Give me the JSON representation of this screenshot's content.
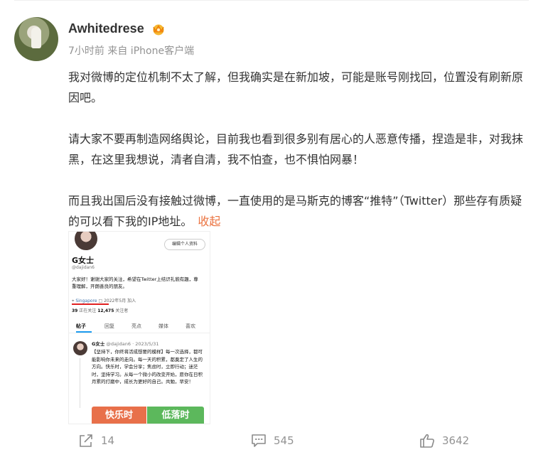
{
  "post": {
    "username": "Awhitedrese",
    "meta": "7小时前 来自 iPhone客户端",
    "paragraphs": [
      "我对微博的定位机制不太了解，但我确实是在新加坡，可能是账号刚找回，位置没有刷新原因吧。",
      "请大家不要再制造网络舆论，目前我也看到很多别有居心的人恶意传播，捏造是非，对我抹黑，在这里我想说，清者自清，我不怕查，也不惧怕网暴！",
      "而且我出国后没有接触过微博，一直使用的是马斯克的博客“推特”（Twitter）那些存有质疑的可以看下我的IP地址。"
    ],
    "collapse_label": "收起",
    "accent_color": "#eb7340"
  },
  "embedded_screenshot": {
    "edit_profile_label": "编辑个人资料",
    "display_name": "G女士",
    "handle": "@dajidan6",
    "bio": "大家好！谢谢大家的关注，希望在Twitter上结识礼貌有趣，尊重理解，开朗善良的朋友。",
    "location": "Singapore",
    "joined": "2022年5月 加入",
    "following_count": "39",
    "following_label": "正在关注",
    "followers_count": "12,475",
    "followers_label": "关注者",
    "tabs": [
      "帖子",
      "回复",
      "亮点",
      "媒体",
      "喜欢"
    ],
    "tweet_author": "G女士",
    "tweet_handle_date": "@dajidan6 · 2023/5/31",
    "tweet_text": "【坚持下，你终将活成想要的模样】每一次选择，都可能影响你未来的走向。每一天的积累，都奠定了人生的方向。快乐时，学会分享；焦虑时，立即行动；迷茫时，坚持学习。从每一个微小的改变开始，愿你在日积月累的打磨中，成长为更好的自己。共勉，早安！",
    "image_left_text": "快乐时",
    "image_right_text": "低落时"
  },
  "actions": {
    "share_count": "14",
    "comment_count": "545",
    "like_count": "3642",
    "share_icon": "share-icon",
    "comment_icon": "comment-icon",
    "like_icon": "thumbs-up-icon"
  }
}
